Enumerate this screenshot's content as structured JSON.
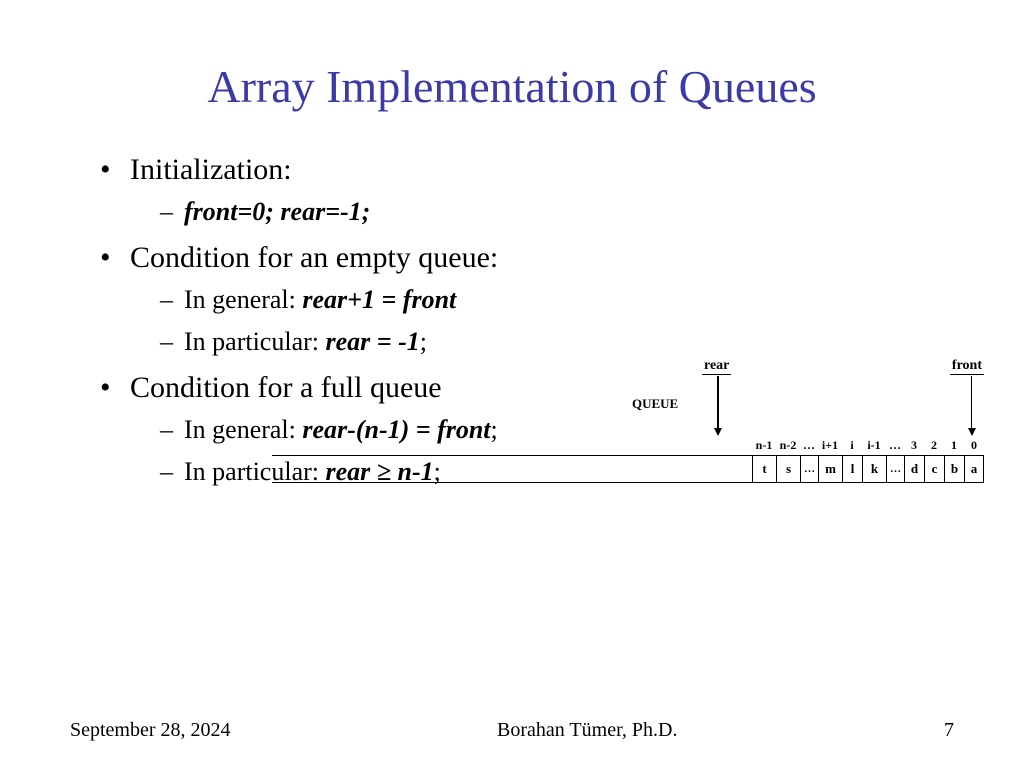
{
  "title": "Array Implementation of Queues",
  "bullets": {
    "b1": "Initialization:",
    "b1a": "front=0; rear=-1;",
    "b2": "Condition for an empty queue:",
    "b2a_pre": "In general: ",
    "b2a_bi": "rear+1 = front",
    "b2b_pre": "In particular: ",
    "b2b_bi": "rear = -1",
    "b2b_post": ";",
    "b3": "Condition for a full queue",
    "b3a_pre": "In general: ",
    "b3a_bi": "rear-(n-1) = front",
    "b3a_post": ";",
    "b3b_pre": "In particular: ",
    "b3b_bi": "rear ≥ n-1",
    "b3b_post": ";"
  },
  "diagram": {
    "rear_label": "rear",
    "front_label": "front",
    "queue_label": "QUEUE",
    "indices": [
      "n-1",
      "n-2",
      "…",
      "i+1",
      "i",
      "i-1",
      "…",
      "3",
      "2",
      "1",
      "0"
    ],
    "cells": [
      "t",
      "s",
      "…",
      "m",
      "l",
      "k",
      "…",
      "d",
      "c",
      "b",
      "a"
    ]
  },
  "footer": {
    "date": "September 28, 2024",
    "author": "Borahan Tümer, Ph.D.",
    "page": "7"
  }
}
